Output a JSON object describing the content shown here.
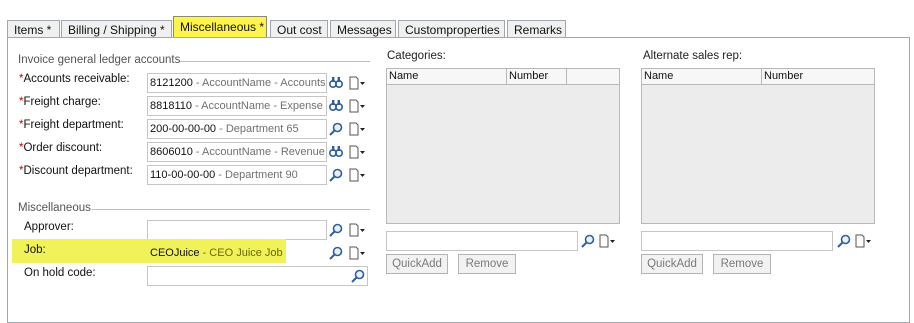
{
  "tabs": [
    {
      "label": "Items *"
    },
    {
      "label": "Billing / Shipping  *"
    },
    {
      "label": "Miscellaneous *"
    },
    {
      "label": "Out cost"
    },
    {
      "label": "Messages"
    },
    {
      "label": "Customproperties"
    },
    {
      "label": "Remarks"
    }
  ],
  "gl_section": {
    "title": "Invoice general ledger accounts",
    "rows": [
      {
        "required": true,
        "label": "Accounts receivable:",
        "code": "8121200",
        "desc": " - AccountName - Accounts Receivable"
      },
      {
        "required": true,
        "label": "Freight charge:",
        "code": "8818110",
        "desc": " - AccountName - Expense"
      },
      {
        "required": true,
        "label": "Freight department:",
        "code": "200-00-00-00",
        "desc": " - Department 65"
      },
      {
        "required": true,
        "label": "Order discount:",
        "code": "8606010",
        "desc": " - AccountName - Revenue"
      },
      {
        "required": true,
        "label": "Discount department:",
        "code": "110-00-00-00",
        "desc": " - Department 90"
      }
    ]
  },
  "misc_section": {
    "title": "Miscellaneous",
    "approver_label": "Approver:",
    "approver_value": "",
    "job_label": "Job:",
    "job_code": "CEOJuice",
    "job_desc": " - CEO Juice Job",
    "onhold_label": "On hold code:",
    "onhold_value": ""
  },
  "categories": {
    "title": "Categories:",
    "columns": [
      "Name",
      "Number"
    ],
    "quickadd": "QuickAdd",
    "remove": "Remove"
  },
  "alt_sales": {
    "title": "Alternate sales rep:",
    "columns": [
      "Name",
      "Number"
    ],
    "quickadd": "QuickAdd",
    "remove": "Remove"
  },
  "colors": {
    "active_tab": "#fff44e",
    "highlight": "#f1f15a",
    "required_star": "#c40000"
  },
  "icons": [
    "magnifier-icon",
    "binoculars-icon",
    "document-dropdown-icon"
  ]
}
